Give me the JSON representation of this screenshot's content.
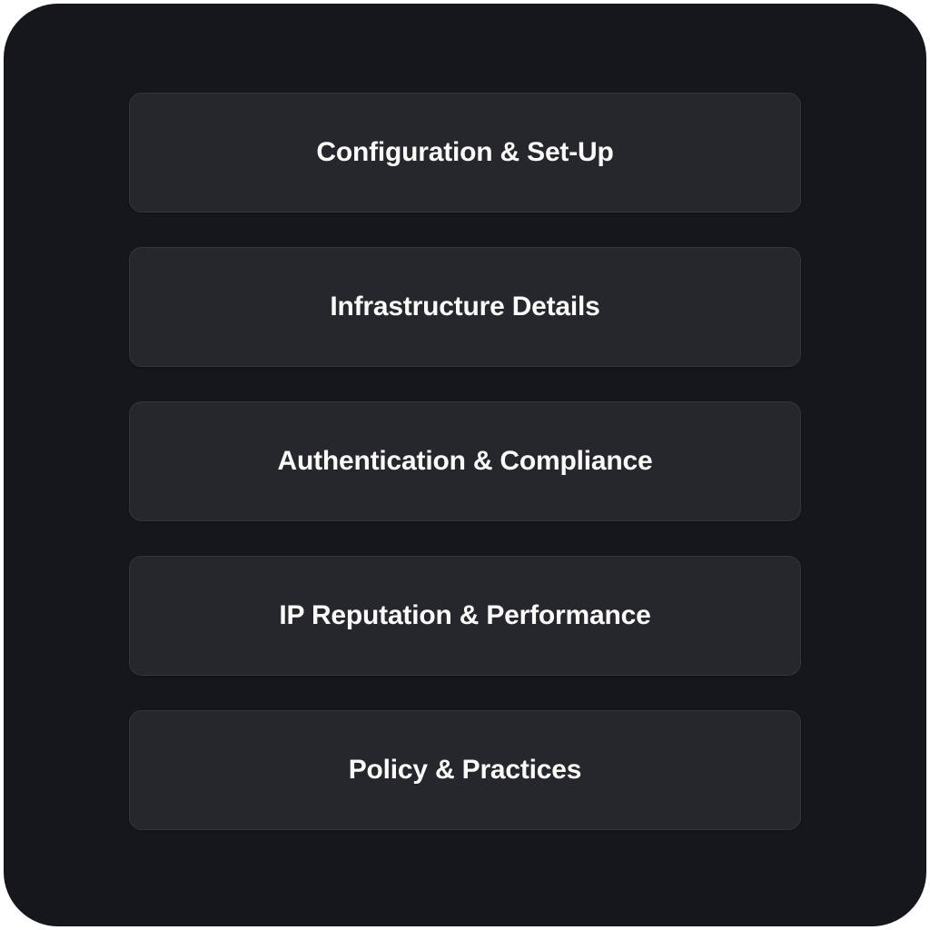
{
  "cards": [
    {
      "label": "Configuration & Set-Up"
    },
    {
      "label": "Infrastructure Details"
    },
    {
      "label": "Authentication & Compliance"
    },
    {
      "label": "IP Reputation & Performance"
    },
    {
      "label": "Policy & Practices"
    }
  ]
}
